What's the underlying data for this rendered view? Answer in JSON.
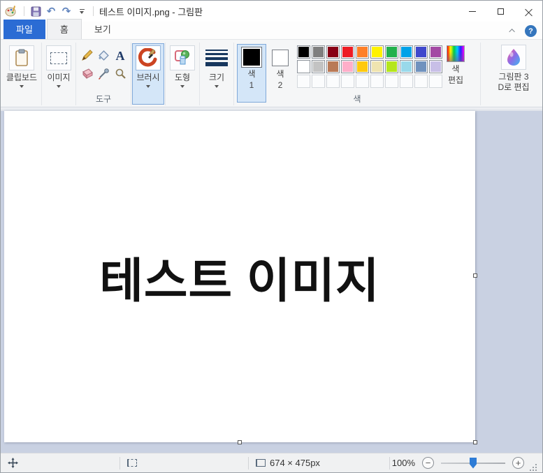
{
  "window": {
    "title": "테스트 이미지.png - 그림판"
  },
  "help": {
    "glyph": "?"
  },
  "tabs": {
    "file": "파일",
    "home": "홈",
    "view": "보기"
  },
  "ribbon": {
    "clipboard": {
      "label": "클립보드"
    },
    "image": {
      "label": "이미지"
    },
    "tools": {
      "label": "도구",
      "text_glyph": "A"
    },
    "brushes": {
      "label": "브러시"
    },
    "shapes": {
      "label": "도형"
    },
    "size": {
      "label": "크기"
    },
    "colors": {
      "label": "색",
      "color1": {
        "line1": "색",
        "line2": "1",
        "value": "#000000"
      },
      "color2": {
        "line1": "색",
        "line2": "2",
        "value": "#ffffff"
      },
      "edit": {
        "line1": "색",
        "line2": "편집"
      },
      "palette": [
        "#000000",
        "#7f7f7f",
        "#880015",
        "#ed1c24",
        "#ff7f27",
        "#fff200",
        "#22b14c",
        "#00a2e8",
        "#3f48cc",
        "#a349a4",
        "#ffffff",
        "#c3c3c3",
        "#b97a57",
        "#ffaec9",
        "#ffc90e",
        "#efe4b0",
        "#b5e61d",
        "#99d9ea",
        "#7092be",
        "#c8bfe7",
        null,
        null,
        null,
        null,
        null,
        null,
        null,
        null,
        null,
        null
      ]
    },
    "paint3d": {
      "line1": "그림판 3",
      "line2": "D로 편집"
    }
  },
  "canvas": {
    "text": "테스트 이미지"
  },
  "statusbar": {
    "dimensions": "674 × 475px",
    "zoom": "100%"
  },
  "theme": {
    "file_tab_blue": "#2b6cd4",
    "ribbon_bg": "#f5f6f7",
    "canvas_surround": "#c9d1e2",
    "highlight_bg": "#d4e6f8",
    "highlight_border": "#7fa8d9",
    "statusbar_bg": "#f0f1f2",
    "slider_blue": "#2e7cd6",
    "help_blue": "#3576bd"
  }
}
